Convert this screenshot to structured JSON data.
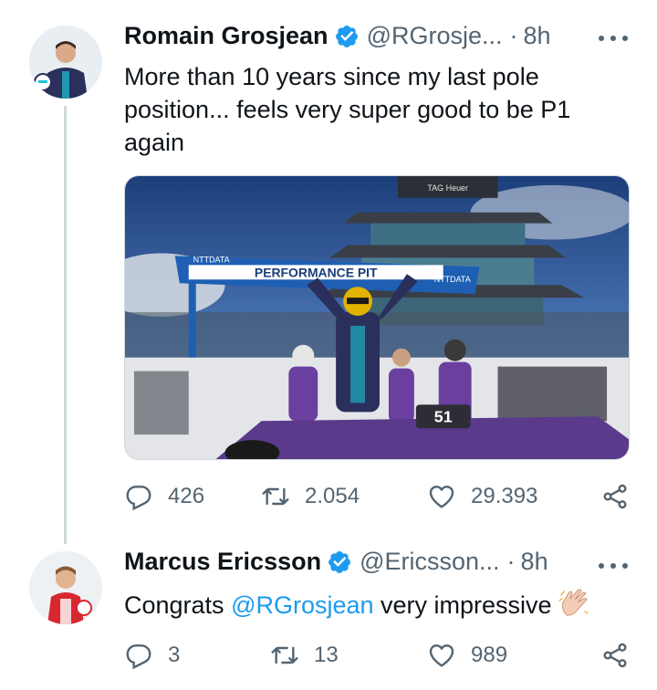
{
  "tweets": [
    {
      "name": "Romain Grosjean",
      "handle": "@RGrosje...",
      "separator": "·",
      "time": "8h",
      "text": "More than 10 years since my last pole position... feels very super good to be P1 again",
      "media": {
        "banner_text": "PERFORMANCE PIT",
        "sponsor": "NTTDATA",
        "tower_brand": "TAG Heuer",
        "car_number": "51"
      },
      "actions": {
        "replies": "426",
        "retweets": "2.054",
        "likes": "29.393"
      }
    },
    {
      "name": "Marcus Ericsson",
      "handle": "@Ericsson...",
      "separator": "·",
      "time": "8h",
      "text_before": "Congrats ",
      "mention": "@RGrosjean",
      "text_after": " very impressive",
      "emoji": "clapping-hands",
      "actions": {
        "replies": "3",
        "retweets": "13",
        "likes": "989"
      }
    }
  ],
  "colors": {
    "accent": "#1d9bf0",
    "secondary_text": "#536471",
    "thread_line": "#cfd9de"
  },
  "icons": [
    "verified-badge-icon",
    "more-icon",
    "reply-icon",
    "retweet-icon",
    "like-icon",
    "share-icon"
  ]
}
